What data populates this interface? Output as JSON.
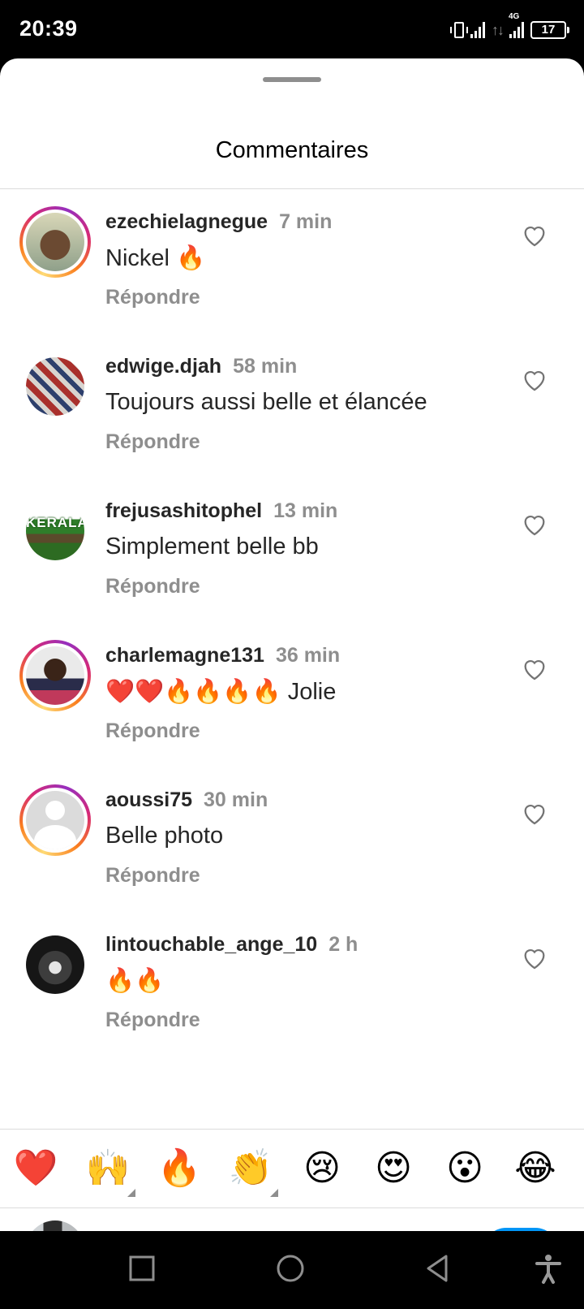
{
  "status_bar": {
    "time": "20:39",
    "network": "4G",
    "battery": "17"
  },
  "sheet": {
    "title": "Commentaires"
  },
  "reply_label": "Répondre",
  "comments": [
    {
      "username": "ezechielagnegue",
      "time": "7 min",
      "text": "Nickel 🔥",
      "avatar": "photo",
      "story_ring": true
    },
    {
      "username": "edwige.djah",
      "time": "58 min",
      "text": "Toujours aussi belle et élancée",
      "avatar": "pattern",
      "story_ring": false
    },
    {
      "username": "frejusashitophel",
      "time": "13 min",
      "text": "Simplement belle bb",
      "avatar": "kerala",
      "avatar_text": "KERALA",
      "story_ring": false
    },
    {
      "username": "charlemagne131",
      "time": "36 min",
      "text": "❤️❤️🔥🔥🔥🔥 Jolie",
      "avatar": "photo",
      "story_ring": true
    },
    {
      "username": "aoussi75",
      "time": "30 min",
      "text": "Belle photo",
      "avatar": "default",
      "story_ring": true
    },
    {
      "username": "lintouchable_ange_10",
      "time": "2 h",
      "text": "🔥🔥",
      "avatar": "photo",
      "story_ring": false
    }
  ],
  "quick_reactions": [
    "❤️",
    "🙌",
    "🔥",
    "👏",
    "😢",
    "😍",
    "😮",
    "😂"
  ],
  "input": {
    "value": "🔥🔥🔥",
    "send_icon": "arrow-up-icon"
  },
  "nav": [
    "square-icon",
    "circle-icon",
    "triangle-back-icon",
    "accessibility-icon"
  ],
  "colors": {
    "accent": "#0095f6",
    "secondary_text": "#8e8e8e",
    "divider": "#dbdbdb"
  }
}
